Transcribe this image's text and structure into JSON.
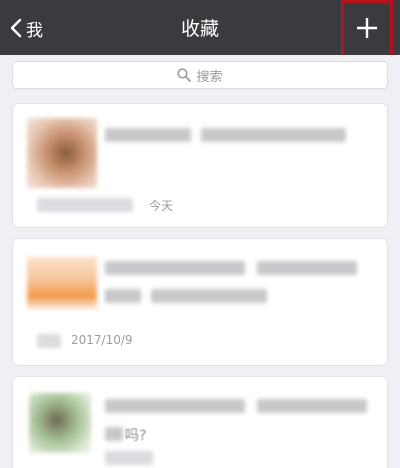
{
  "navbar": {
    "back_label": "我",
    "title": "收藏"
  },
  "search": {
    "label": "搜索"
  },
  "items": [
    {
      "date": "今天"
    },
    {
      "date": "2017/10/9"
    },
    {
      "text_fragment": "吗?"
    }
  ],
  "colors": {
    "navbar_bg": "#3a3a3f",
    "page_bg": "#efeff4",
    "highlight": "#b3121e"
  }
}
